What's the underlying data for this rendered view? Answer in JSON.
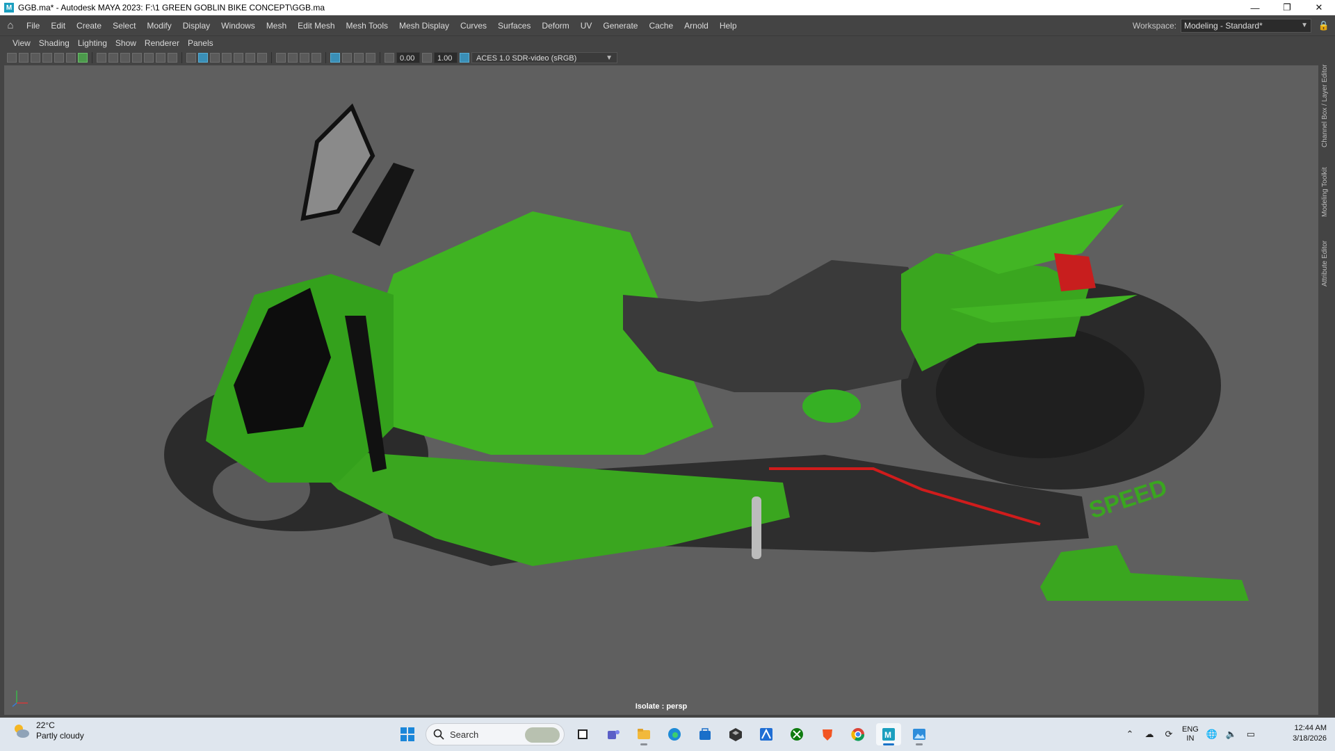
{
  "window": {
    "title": "GGB.ma* - Autodesk MAYA 2023: F:\\1 GREEN GOBLIN BIKE CONCEPT\\GGB.ma",
    "app_icon": "M",
    "minimize": "—",
    "maximize": "❐",
    "close": "✕"
  },
  "menubar": {
    "items": [
      "File",
      "Edit",
      "Create",
      "Select",
      "Modify",
      "Display",
      "Windows",
      "Mesh",
      "Edit Mesh",
      "Mesh Tools",
      "Mesh Display",
      "Curves",
      "Surfaces",
      "Deform",
      "UV",
      "Generate",
      "Cache",
      "Arnold",
      "Help"
    ],
    "workspace_label": "Workspace:",
    "workspace_value": "Modeling - Standard*"
  },
  "panel_menu": {
    "items": [
      "View",
      "Shading",
      "Lighting",
      "Show",
      "Renderer",
      "Panels"
    ]
  },
  "panel_toolbar": {
    "exposure": "0.00",
    "gamma": "1.00",
    "color_space": "ACES 1.0 SDR-video (sRGB)"
  },
  "viewport": {
    "isolate_label": "Isolate : persp",
    "background": "#5f5f5f",
    "model_green": "#3aa61f",
    "model_dark": "#2c2c2c",
    "wheel_text": "SPEED"
  },
  "side_tabs": [
    "Channel Box / Layer Editor",
    "Modeling Toolkit",
    "Attribute Editor"
  ],
  "taskbar": {
    "weather_temp": "22°C",
    "weather_cond": "Partly cloudy",
    "search_placeholder": "Search",
    "lang_top": "ENG",
    "lang_bottom": "IN",
    "time": "12:44 AM",
    "date": "3/18/2026"
  }
}
